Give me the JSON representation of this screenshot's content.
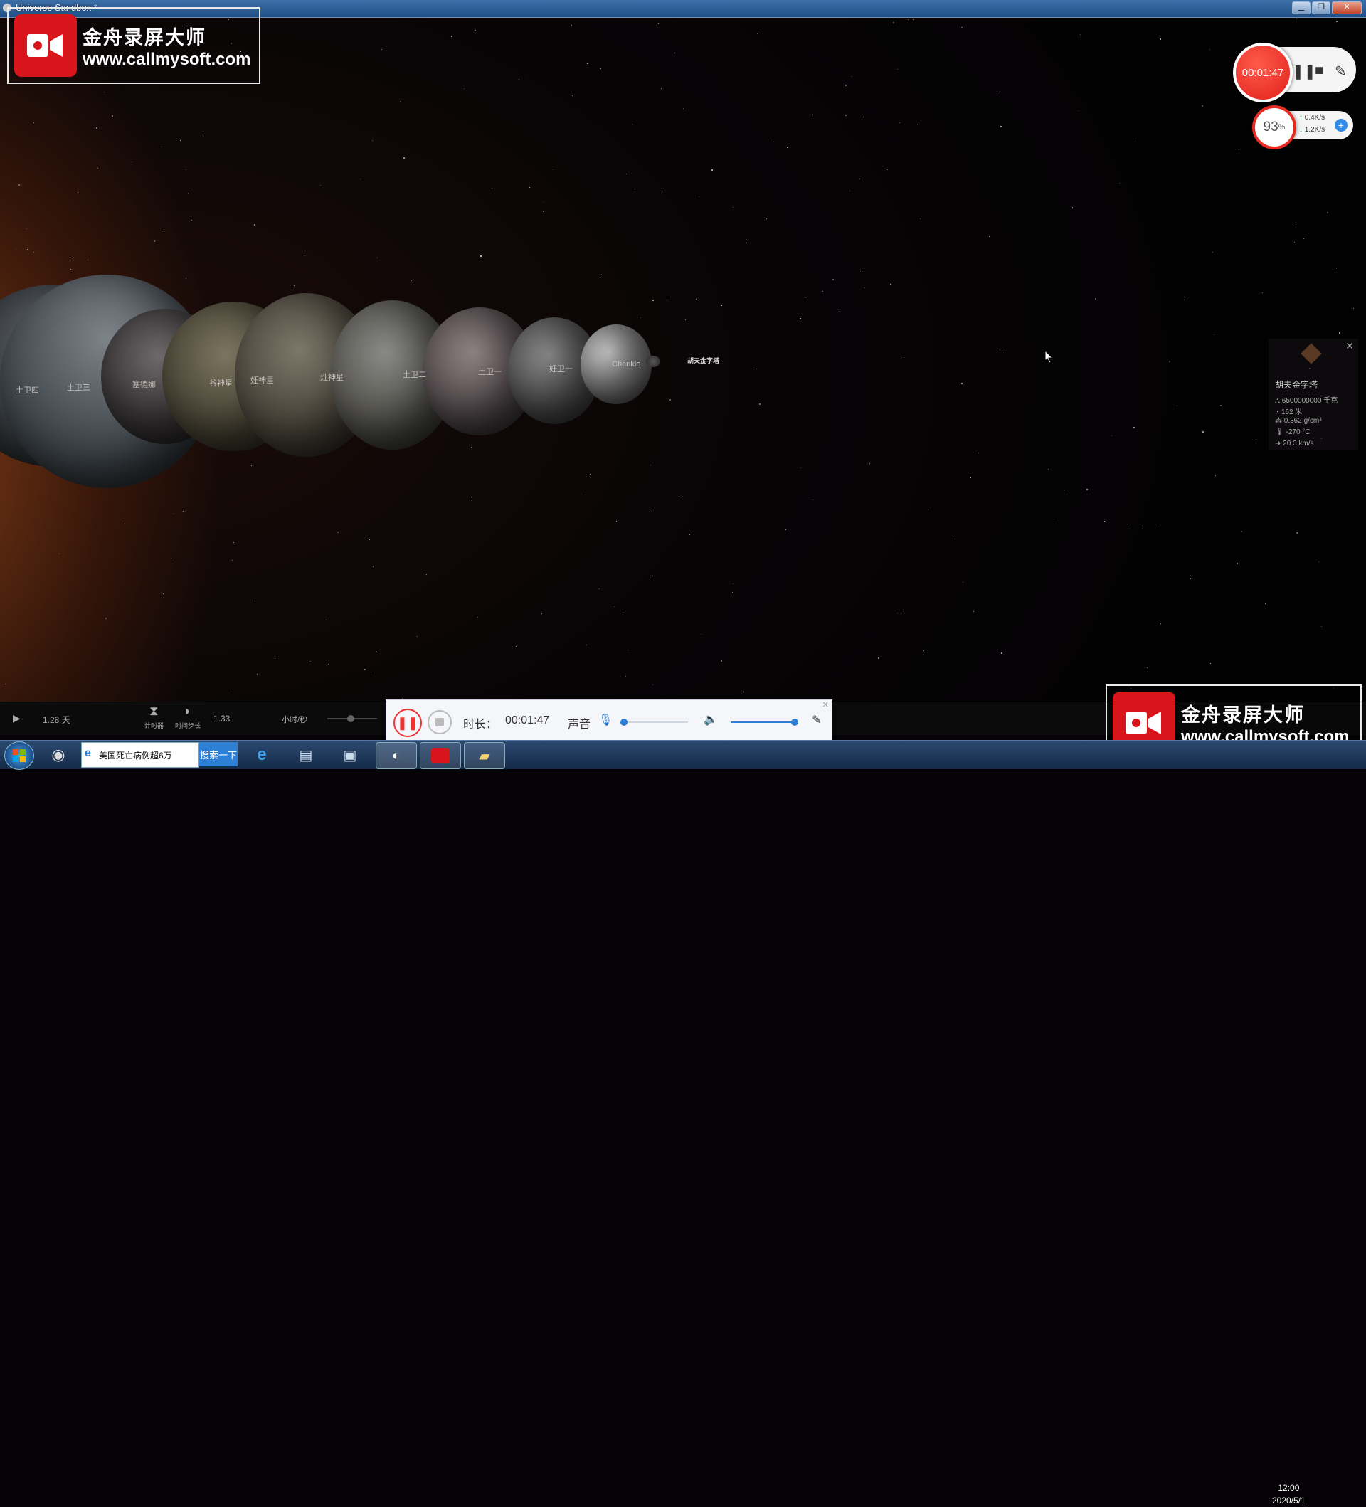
{
  "window": {
    "title": "Universe Sandbox ²"
  },
  "watermark": {
    "brand": "金舟录屏大师",
    "url": "www.callmysoft.com"
  },
  "planet_labels": [
    "土卫四",
    "土卫三",
    "塞德娜",
    "谷神星",
    "妊神星",
    "灶神星",
    "土卫二",
    "土卫一",
    "妊卫一",
    "Chariklo",
    "胡夫金字塔"
  ],
  "recorder_widget": {
    "time": "00:01:47"
  },
  "network_widget": {
    "percent": "93",
    "percent_unit": "%",
    "up": "0.4K/s",
    "down": "1.2K/s"
  },
  "info_panel": {
    "name": "胡夫金字塔",
    "rows": [
      "6500000000 千克",
      "162 米",
      "0.362 g/cm³",
      "-270 °C",
      "20.3 km/s"
    ]
  },
  "control_bar": {
    "elapsed": "1.28 天",
    "timer_label": "计时器",
    "timestep_label": "时间步长",
    "rate_value": "1.33",
    "rate_unit": "小时/秒"
  },
  "recorder_toolbar": {
    "duration_label": "时长：",
    "duration_value": "00:01:47",
    "sound_label": "声音",
    "mic_level": 0.0,
    "volume_level": 1.0
  },
  "taskbar": {
    "search_text": "美国死亡病例超6万",
    "search_button": "搜索一下",
    "time": "12:00",
    "date": "2020/5/1"
  },
  "colors": {
    "record_red": "#e0211b",
    "accent_blue": "#2b7fd8"
  }
}
